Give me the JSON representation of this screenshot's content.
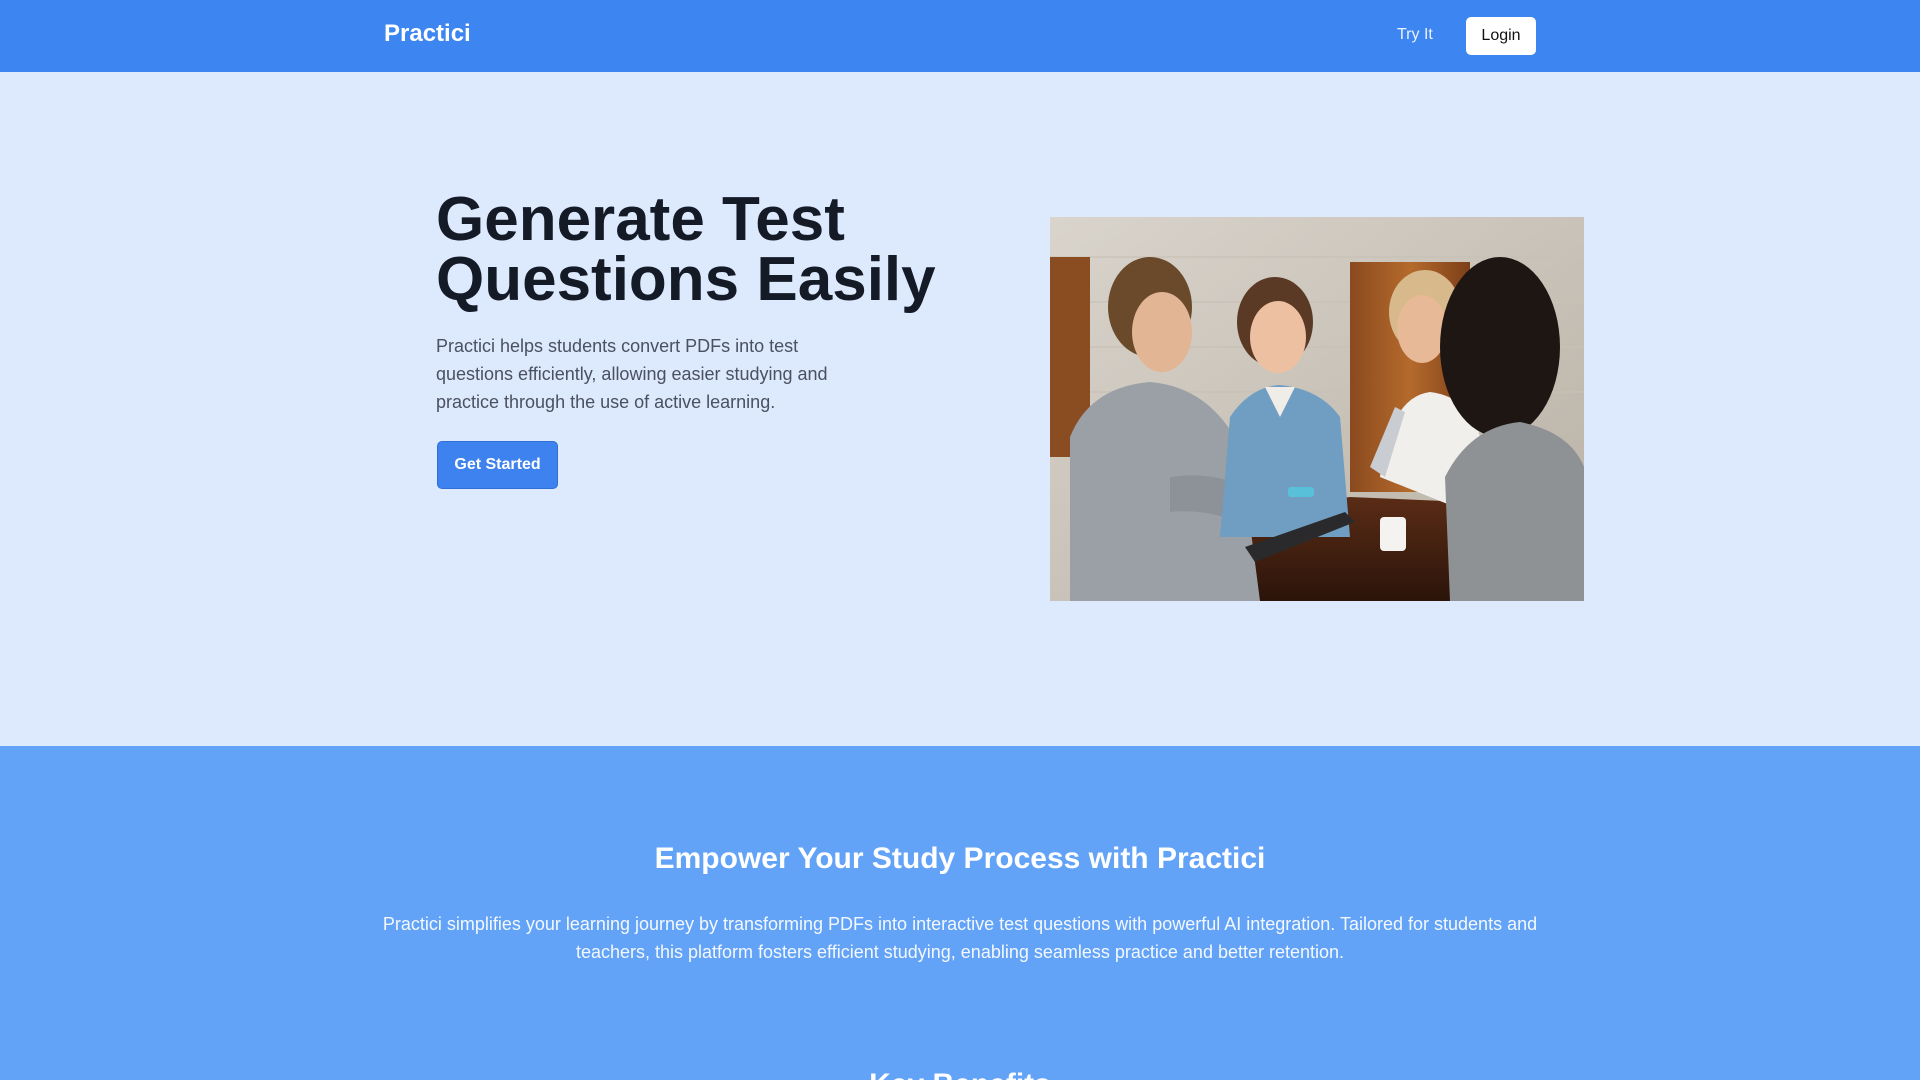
{
  "navbar": {
    "brand": "Practici",
    "try_it": "Try It",
    "login": "Login"
  },
  "hero": {
    "title": "Generate Test Questions Easily",
    "description": "Practici helps students convert PDFs into test questions efficiently, allowing easier studying and practice through the use of active learning.",
    "cta": "Get Started",
    "image": "students-studying-photo"
  },
  "benefits": {
    "title": "Empower Your Study Process with Practici",
    "description": "Practici simplifies your learning journey by transforming PDFs into interactive test questions with powerful AI integration. Tailored for students and teachers, this platform fosters efficient studying, enabling seamless practice and better retention.",
    "next_heading": "Key Benefits"
  },
  "colors": {
    "navbar": "#3d85f0",
    "hero_bg": "#dde9fd",
    "button": "#3d82ee",
    "section_bg": "#63a3f7"
  }
}
